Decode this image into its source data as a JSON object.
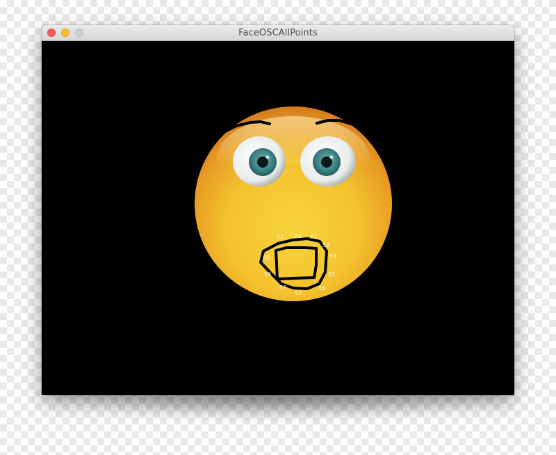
{
  "window": {
    "title": "FaceOSCAllPoints"
  },
  "traffic_lights": {
    "close_color": "#fc5f57",
    "minimize_color": "#fdbc2e",
    "zoom_color": "#d0d0d0"
  },
  "canvas": {
    "background": "#000000",
    "emoji_icon": "shocked-emoji-face-icon",
    "stroke_color": "#000000"
  },
  "point_labels": [
    "52",
    "51",
    "52",
    "53",
    "54",
    "55",
    "56",
    "57",
    "58",
    "59",
    "60"
  ]
}
